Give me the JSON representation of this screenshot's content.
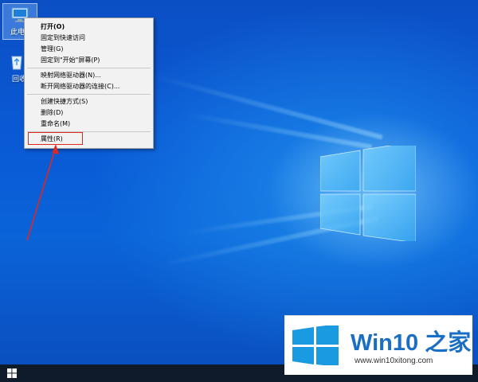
{
  "desktop_icons": [
    {
      "name": "this-pc",
      "label": "此电脑",
      "icon": "computer-icon"
    },
    {
      "name": "recycle-bin",
      "label": "回收站",
      "icon": "recycle-bin-icon"
    }
  ],
  "context_menu": {
    "items": [
      {
        "label": "打开(O)",
        "bold": true
      },
      {
        "label": "固定到快速访问"
      },
      {
        "label": "管理(G)"
      },
      {
        "label": "固定到\"开始\"屏幕(P)"
      },
      {
        "label": "映射网络驱动器(N)..."
      },
      {
        "label": "断开网络驱动器的连接(C)..."
      },
      {
        "label": "创建快捷方式(S)"
      },
      {
        "label": "删除(D)"
      },
      {
        "label": "重命名(M)"
      },
      {
        "label": "属性(R)",
        "highlighted": true
      }
    ]
  },
  "annotation": {
    "highlight_color": "#e0281f",
    "target": "属性(R)"
  },
  "taskbar": {
    "start_icon": "windows-start-icon"
  },
  "watermark": {
    "title": "Win10 之家",
    "url": "www.win10xitong.com",
    "title_color": "#1a6fc4",
    "logo_color": "#1a9ae0"
  }
}
